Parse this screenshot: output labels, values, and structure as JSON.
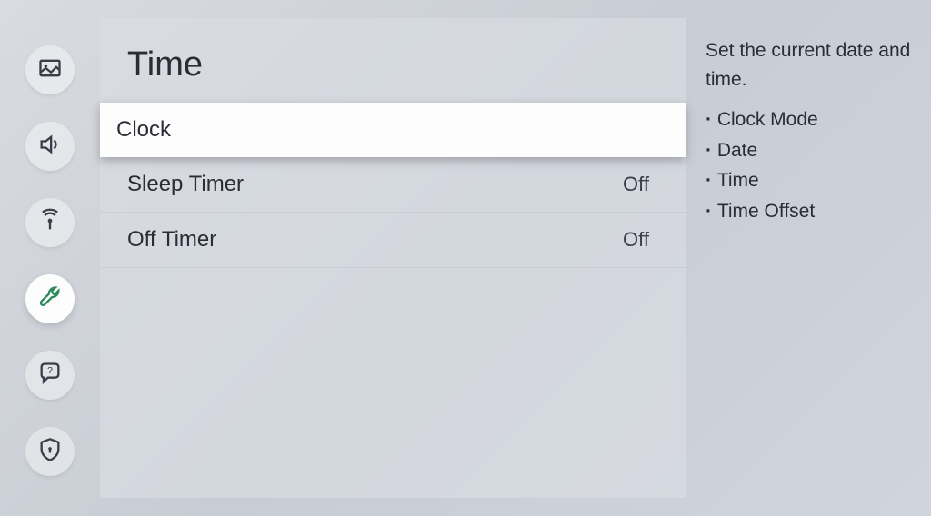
{
  "page": {
    "title": "Time"
  },
  "menu": {
    "items": [
      {
        "label": "Clock",
        "value": ""
      },
      {
        "label": "Sleep Timer",
        "value": "Off"
      },
      {
        "label": "Off Timer",
        "value": "Off"
      }
    ]
  },
  "info": {
    "description": "Set the current date and time.",
    "options": [
      "Clock Mode",
      "Date",
      "Time",
      "Time Offset"
    ]
  }
}
